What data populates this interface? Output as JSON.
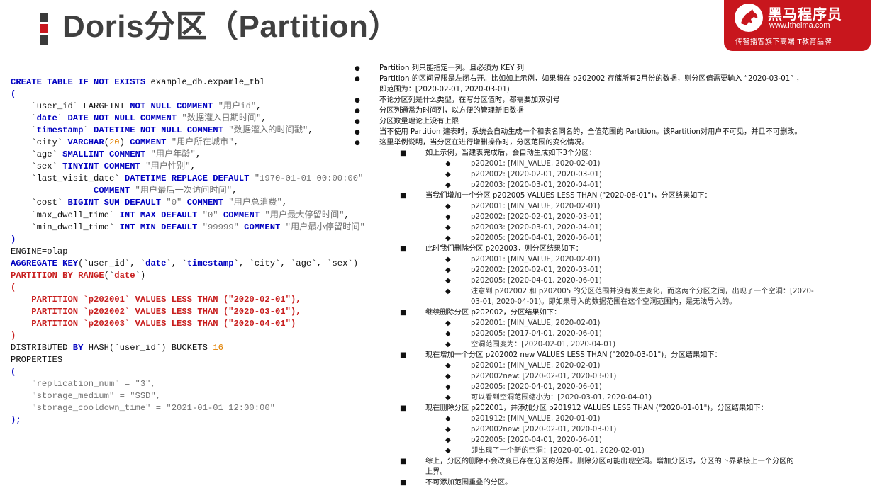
{
  "title": "Doris分区（Partition）",
  "logo": {
    "name": "黑马程序员",
    "url": "www.itheima.com",
    "slogan": "传智播客旗下高端IT教育品牌"
  },
  "code_lines": [
    [
      [
        "kw",
        "CREATE TABLE IF NOT EXISTS "
      ],
      [
        "plain",
        "example_db.expamle_tbl"
      ]
    ],
    [
      [
        "kw",
        "("
      ]
    ],
    [
      [
        "plain",
        "    `user_id` LARGEINT "
      ],
      [
        "kw",
        "NOT NULL COMMENT "
      ],
      [
        "cm",
        "\"用户id\""
      ],
      [
        "plain",
        ","
      ]
    ],
    [
      [
        "plain",
        "    `"
      ],
      [
        "kw",
        "date"
      ],
      [
        "plain",
        "` "
      ],
      [
        "kw",
        "DATE NOT NULL COMMENT "
      ],
      [
        "cm",
        "\"数据灌入日期时间\""
      ],
      [
        "plain",
        ","
      ]
    ],
    [
      [
        "plain",
        "    `"
      ],
      [
        "kw",
        "timestamp"
      ],
      [
        "plain",
        "` "
      ],
      [
        "kw",
        "DATETIME NOT NULL COMMENT "
      ],
      [
        "cm",
        "\"数据灌入的时间戳\""
      ],
      [
        "plain",
        ","
      ]
    ],
    [
      [
        "plain",
        "    `city` "
      ],
      [
        "kw",
        "VARCHAR"
      ],
      [
        "plain",
        "("
      ],
      [
        "num",
        "20"
      ],
      [
        "plain",
        ") "
      ],
      [
        "kw",
        "COMMENT "
      ],
      [
        "cm",
        "\"用户所在城市\""
      ],
      [
        "plain",
        ","
      ]
    ],
    [
      [
        "plain",
        "    `age` "
      ],
      [
        "kw",
        "SMALLINT COMMENT "
      ],
      [
        "cm",
        "\"用户年龄\""
      ],
      [
        "plain",
        ","
      ]
    ],
    [
      [
        "plain",
        "    `sex` "
      ],
      [
        "kw",
        "TINYINT COMMENT "
      ],
      [
        "cm",
        "\"用户性别\""
      ],
      [
        "plain",
        ","
      ]
    ],
    [
      [
        "plain",
        "    `last_visit_date` "
      ],
      [
        "kw",
        "DATETIME REPLACE DEFAULT "
      ],
      [
        "cm",
        "\"1970-01-01 00:00:00\""
      ]
    ],
    [
      [
        "plain",
        "                "
      ],
      [
        "kw",
        "COMMENT "
      ],
      [
        "cm",
        "\"用户最后一次访问时间\""
      ],
      [
        "plain",
        ","
      ]
    ],
    [
      [
        "plain",
        "    `cost` "
      ],
      [
        "kw",
        "BIGINT SUM DEFAULT "
      ],
      [
        "cm",
        "\"0\" "
      ],
      [
        "kw",
        "COMMENT "
      ],
      [
        "cm",
        "\"用户总消费\""
      ],
      [
        "plain",
        ","
      ]
    ],
    [
      [
        "plain",
        "    `max_dwell_time` "
      ],
      [
        "kw",
        "INT MAX DEFAULT "
      ],
      [
        "cm",
        "\"0\" "
      ],
      [
        "kw",
        "COMMENT "
      ],
      [
        "cm",
        "\"用户最大停留时间\""
      ],
      [
        "plain",
        ","
      ]
    ],
    [
      [
        "plain",
        "    `min_dwell_time` "
      ],
      [
        "kw",
        "INT MIN DEFAULT "
      ],
      [
        "cm",
        "\"99999\" "
      ],
      [
        "kw",
        "COMMENT "
      ],
      [
        "cm",
        "\"用户最小停留时间\""
      ]
    ],
    [
      [
        "kw",
        ")"
      ]
    ],
    [
      [
        "plain",
        "ENGINE=olap"
      ]
    ],
    [
      [
        "kw",
        "AGGREGATE KEY"
      ],
      [
        "plain",
        "(`user_id`, `"
      ],
      [
        "kw",
        "date"
      ],
      [
        "plain",
        "`, `"
      ],
      [
        "kw",
        "timestamp"
      ],
      [
        "plain",
        "`, `city`, `age`, `sex`)"
      ]
    ],
    [
      [
        "red",
        "PARTITION BY RANGE"
      ],
      [
        "plain",
        "(`"
      ],
      [
        "red",
        "date"
      ],
      [
        "plain",
        "`)"
      ]
    ],
    [
      [
        "red",
        "("
      ]
    ],
    [
      [
        "red",
        "    PARTITION `p202001` VALUES LESS THAN (\"2020-02-01\"),"
      ]
    ],
    [
      [
        "red",
        "    PARTITION `p202002` VALUES LESS THAN (\"2020-03-01\"),"
      ]
    ],
    [
      [
        "red",
        "    PARTITION `p202003` VALUES LESS THAN (\"2020-04-01\")"
      ]
    ],
    [
      [
        "red",
        ")"
      ]
    ],
    [
      [
        "plain",
        "DISTRIBUTED "
      ],
      [
        "kw",
        "BY "
      ],
      [
        "plain",
        "HASH(`user_id`) BUCKETS "
      ],
      [
        "num",
        "16"
      ]
    ],
    [
      [
        "plain",
        "PROPERTIES"
      ]
    ],
    [
      [
        "kw",
        "("
      ]
    ],
    [
      [
        "cm",
        "    \"replication_num\" = \"3\","
      ]
    ],
    [
      [
        "cm",
        "    \"storage_medium\" = \"SSD\","
      ]
    ],
    [
      [
        "cm",
        "    \"storage_cooldown_time\" = \"2021-01-01 12:00:00\""
      ]
    ],
    [
      [
        "kw",
        ");"
      ]
    ]
  ],
  "notes": [
    {
      "level": 1,
      "text": "Partition 列只能指定一列。且必须为 KEY 列"
    },
    {
      "level": 1,
      "text": "Partition 的区间界限是左闭右开。比如如上示例，如果想在 p202002 存储所有2月份的数据，则分区值需要输入 “2020-03-01” ，"
    },
    {
      "level": 0,
      "text": "即范围为：[2020-02-01, 2020-03-01)"
    },
    {
      "level": 1,
      "text": "不论分区列是什么类型，在写分区值时，都需要加双引号"
    },
    {
      "level": 1,
      "text": "分区列通常为时间列，以方便的管理新旧数据"
    },
    {
      "level": 1,
      "text": "分区数量理论上没有上限"
    },
    {
      "level": 1,
      "text": "当不使用 Partition 建表时，系统会自动生成一个和表名同名的，全值范围的 Partition。该Partition对用户不可见，并且不可删改。"
    },
    {
      "level": 1,
      "text": "这里举例说明，当分区在进行增删操作时，分区范围的变化情况。"
    },
    {
      "level": 2,
      "text": "如上示例，当建表完成后，会自动生成如下3个分区："
    },
    {
      "level": 3,
      "text": "p202001: [MIN_VALUE, 2020-02-01)"
    },
    {
      "level": 3,
      "text": "p202002: [2020-02-01, 2020-03-01)"
    },
    {
      "level": 3,
      "text": "p202003: [2020-03-01, 2020-04-01)"
    },
    {
      "level": 2,
      "text": "当我们增加一个分区 p202005 VALUES LESS THAN (\"2020-06-01\")，分区结果如下："
    },
    {
      "level": 3,
      "text": "p202001: [MIN_VALUE, 2020-02-01)"
    },
    {
      "level": 3,
      "text": "p202002: [2020-02-01, 2020-03-01)"
    },
    {
      "level": 3,
      "text": "p202003: [2020-03-01, 2020-04-01)"
    },
    {
      "level": 3,
      "text": "p202005: [2020-04-01, 2020-06-01)"
    },
    {
      "level": 2,
      "text": "此时我们删除分区 p202003，则分区结果如下："
    },
    {
      "level": 3,
      "text": "p202001: [MIN_VALUE, 2020-02-01)"
    },
    {
      "level": 3,
      "text": "p202002: [2020-02-01, 2020-03-01)"
    },
    {
      "level": 3,
      "text": "p202005: [2020-04-01, 2020-06-01)"
    },
    {
      "level": 3,
      "text": "注意到 p202002 和 p202005 的分区范围并没有发生变化，而这两个分区之间，出现了一个空洞：[2020-"
    },
    {
      "level": -3,
      "text": "03-01, 2020-04-01)。即如果导入的数据范围在这个空洞范围内，是无法导入的。"
    },
    {
      "level": 2,
      "text": "继续删除分区 p202002，分区结果如下："
    },
    {
      "level": 3,
      "text": "p202001: [MIN_VALUE, 2020-02-01)"
    },
    {
      "level": 3,
      "text": "p202005: [2017-04-01, 2020-06-01)"
    },
    {
      "level": 3,
      "text": "空洞范围变为：[2020-02-01, 2020-04-01)"
    },
    {
      "level": 2,
      "text": "现在增加一个分区 p202002 new VALUES LESS THAN (\"2020-03-01\")，分区结果如下："
    },
    {
      "level": 3,
      "text": "p202001: [MIN_VALUE, 2020-02-01)"
    },
    {
      "level": 3,
      "text": "p202002new: [2020-02-01, 2020-03-01)"
    },
    {
      "level": 3,
      "text": "p202005: [2020-04-01, 2020-06-01)"
    },
    {
      "level": 3,
      "text": "可以看到空洞范围缩小为：[2020-03-01, 2020-04-01)"
    },
    {
      "level": 2,
      "text": "现在删除分区 p202001，并添加分区 p201912 VALUES LESS THAN (\"2020-01-01\")，分区结果如下："
    },
    {
      "level": 3,
      "text": "p201912: [MIN_VALUE, 2020-01-01)"
    },
    {
      "level": 3,
      "text": "p202002new: [2020-02-01, 2020-03-01)"
    },
    {
      "level": 3,
      "text": "p202005: [2020-04-01, 2020-06-01)"
    },
    {
      "level": 3,
      "text": "即出现了一个新的空洞：[2020-01-01, 2020-02-01)"
    },
    {
      "level": 2,
      "text": "综上，分区的删除不会改变已存在分区的范围。删除分区可能出现空洞。增加分区时，分区的下界紧接上一个分区的"
    },
    {
      "level": -2,
      "text": "上界。"
    },
    {
      "level": 2,
      "text": "不可添加范围重叠的分区。"
    }
  ],
  "bullets": {
    "level1": "●",
    "level2": "■",
    "level3": "◆"
  }
}
